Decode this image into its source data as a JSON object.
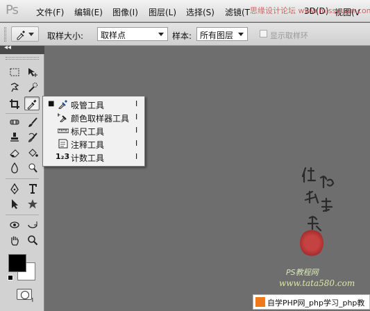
{
  "app": {
    "logo": "Ps"
  },
  "menubar": {
    "items": [
      "文件(F)",
      "编辑(E)",
      "图像(I)",
      "图层(L)",
      "选择(S)",
      "滤镜(T",
      "3D(D)",
      "视图(V"
    ],
    "overlay_text": "思缘设计论坛  www.missyuan.com"
  },
  "options": {
    "sample_size_label": "取样大小:",
    "sample_size_value": "取样点",
    "sample_label": "样本:",
    "sample_value": "所有图层",
    "show_ring_label": "显示取样环"
  },
  "toolbox": {
    "collapse_glyph": "◂◂"
  },
  "flyout": {
    "items": [
      {
        "bullet": "■",
        "label": "吸管工具",
        "key": "I",
        "icon": "eyedropper-icon"
      },
      {
        "bullet": "",
        "label": "颜色取样器工具",
        "key": "I",
        "icon": "color-sampler-icon"
      },
      {
        "bullet": "",
        "label": "标尺工具",
        "key": "I",
        "icon": "ruler-icon"
      },
      {
        "bullet": "",
        "label": "注释工具",
        "key": "I",
        "icon": "note-icon"
      },
      {
        "bullet": "",
        "label": "计数工具",
        "key": "I",
        "icon": "count-icon",
        "icon_text": "1₂3"
      }
    ]
  },
  "canvas": {
    "brush_text": "他她我帮你",
    "ps_text": "PS教程网",
    "url_text": "www.tata580.com"
  },
  "banner": {
    "text": "自学PHP网_php学习_php教"
  }
}
